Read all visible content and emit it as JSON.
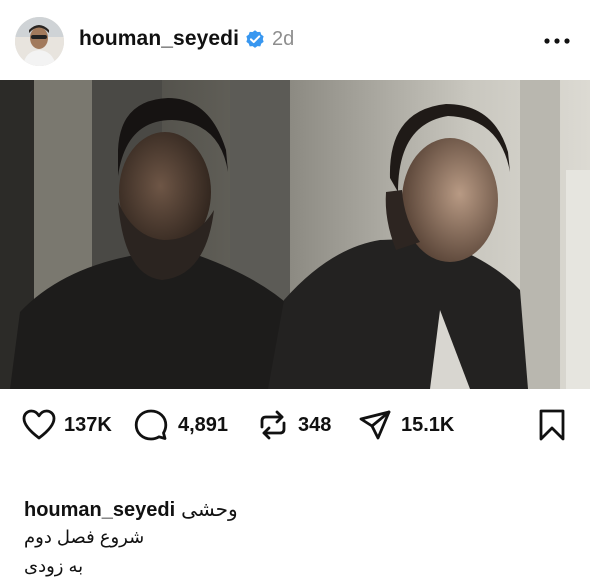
{
  "post": {
    "username": "houman_seyedi",
    "verified": true,
    "timestamp": "2d",
    "more_icon": "more-horizontal-icon",
    "avatar_icon": "profile-avatar",
    "photo_icon": "post-photo"
  },
  "actions": {
    "likes": "137K",
    "comments": "4,891",
    "reposts": "348",
    "shares": "15.1K",
    "icons": [
      "heart-icon",
      "comment-icon",
      "repost-icon",
      "send-icon",
      "bookmark-icon"
    ]
  },
  "caption": {
    "username": "houman_seyedi",
    "line1": "وحشی",
    "line2": "شروع فصل دوم",
    "line3": "به زودی"
  },
  "colors": {
    "verified_blue": "#3897f0",
    "muted_gray": "#8e8e8e",
    "text": "#111111"
  }
}
